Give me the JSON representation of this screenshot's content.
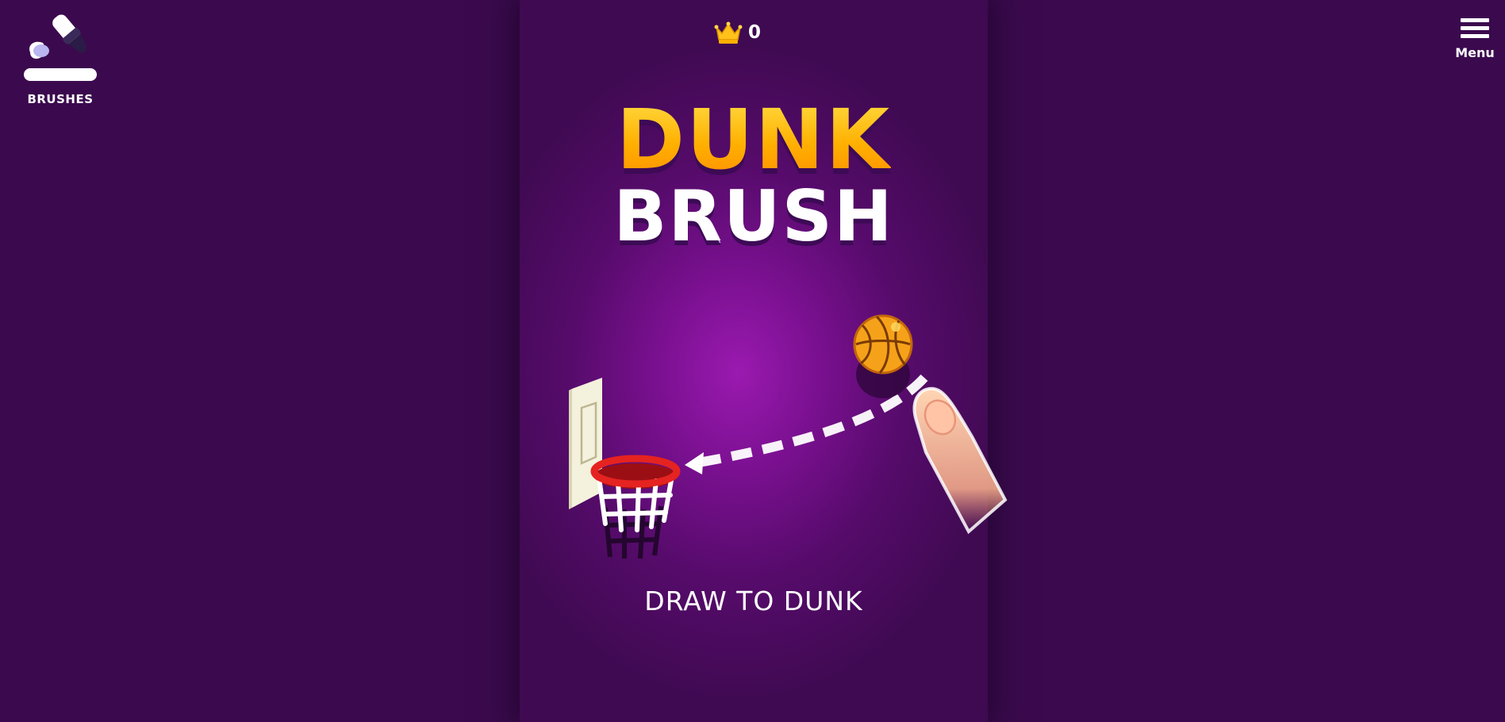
{
  "header": {
    "brushes_label": "BRUSHES",
    "menu_label": "Menu",
    "score": "0"
  },
  "title": {
    "line1": "DUNK",
    "line2": "BRUSH"
  },
  "instruction": "DRAW TO DUNK",
  "colors": {
    "background": "#3b0a4e",
    "panel_center": "#9a1ab0",
    "title_gold": "#ffb300",
    "title_white": "#ffffff",
    "rim_red": "#e52320",
    "ball_orange": "#f5a21a"
  },
  "icons": {
    "brushes": "paintbrush-icon",
    "menu": "hamburger-icon",
    "score": "crown-icon"
  }
}
